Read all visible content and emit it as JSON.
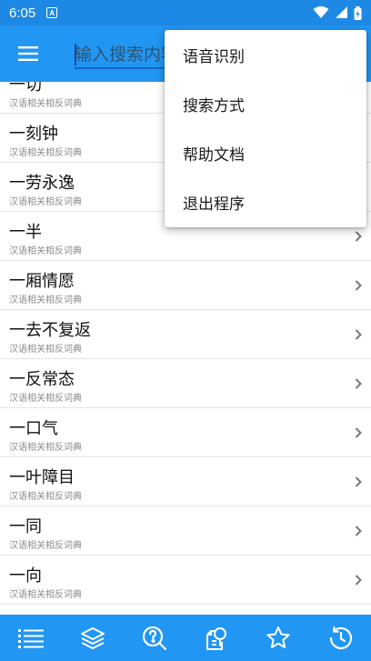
{
  "status": {
    "time": "6:05",
    "indicator": "A"
  },
  "toolbar": {
    "search_placeholder": "输入搜索内容",
    "menu_icon": "hamburger-menu-icon"
  },
  "popup_menu": {
    "items": [
      {
        "label": "语音识别"
      },
      {
        "label": "搜索方式"
      },
      {
        "label": "帮助文档"
      },
      {
        "label": "退出程序"
      }
    ]
  },
  "list": {
    "items": [
      {
        "title": "一切",
        "subtitle": "汉语相关相反词典"
      },
      {
        "title": "一刻钟",
        "subtitle": "汉语相关相反词典"
      },
      {
        "title": "一劳永逸",
        "subtitle": "汉语相关相反词典"
      },
      {
        "title": "一半",
        "subtitle": "汉语相关相反词典"
      },
      {
        "title": "一厢情愿",
        "subtitle": "汉语相关相反词典"
      },
      {
        "title": "一去不复返",
        "subtitle": "汉语相关相反词典"
      },
      {
        "title": "一反常态",
        "subtitle": "汉语相关相反词典"
      },
      {
        "title": "一口气",
        "subtitle": "汉语相关相反词典"
      },
      {
        "title": "一叶障目",
        "subtitle": "汉语相关相反词典"
      },
      {
        "title": "一同",
        "subtitle": "汉语相关相反词典"
      },
      {
        "title": "一向",
        "subtitle": "汉语相关相反词典"
      }
    ]
  },
  "bottom_nav": {
    "icons": [
      "list-icon",
      "layers-icon",
      "search-question-icon",
      "page-search-icon",
      "star-icon",
      "history-icon"
    ]
  },
  "colors": {
    "primary": "#2196f3",
    "status_bar": "#1e88e5",
    "subtitle": "#8a8a8a"
  }
}
